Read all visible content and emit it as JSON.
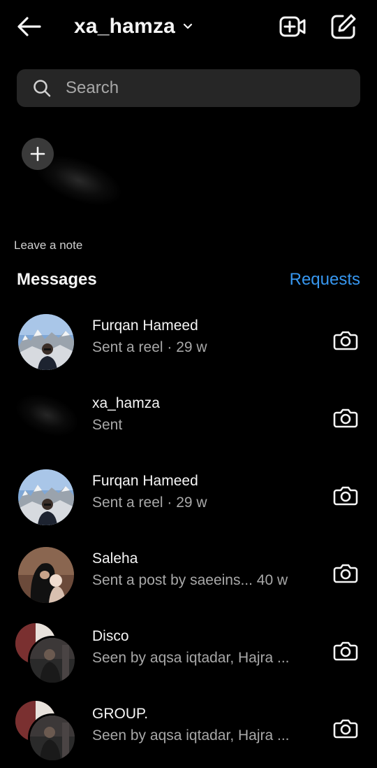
{
  "header": {
    "username": "xa_hamza",
    "back_icon": "arrow-left-icon",
    "dropdown_icon": "chevron-down-icon",
    "video_icon": "new-video-call-icon",
    "compose_icon": "new-message-icon"
  },
  "search": {
    "placeholder": "Search",
    "value": ""
  },
  "note": {
    "label": "Leave a note",
    "add_icon": "plus-icon"
  },
  "section": {
    "title": "Messages",
    "requests_label": "Requests"
  },
  "threads": [
    {
      "name": "Furqan Hameed",
      "preview": "Sent a reel · 29 w",
      "avatar": "mountain-photo"
    },
    {
      "name": "xa_hamza",
      "preview": "Sent",
      "avatar": "blurred"
    },
    {
      "name": "Furqan Hameed",
      "preview": "Sent a reel · 29 w",
      "avatar": "mountain-photo"
    },
    {
      "name": "Saleha",
      "preview": "Sent a post by saeeins...  40 w",
      "avatar": "portrait-photo"
    },
    {
      "name": "Disco",
      "preview": "Seen by aqsa iqtadar, Hajra ...",
      "avatar": "group-photo"
    },
    {
      "name": "GROUP.",
      "preview": "Seen by aqsa iqtadar, Hajra ...",
      "avatar": "group-photo"
    }
  ],
  "colors": {
    "background": "#000000",
    "search_bg": "#262626",
    "accent": "#3797f0",
    "secondary_text": "#a8a8a8"
  }
}
